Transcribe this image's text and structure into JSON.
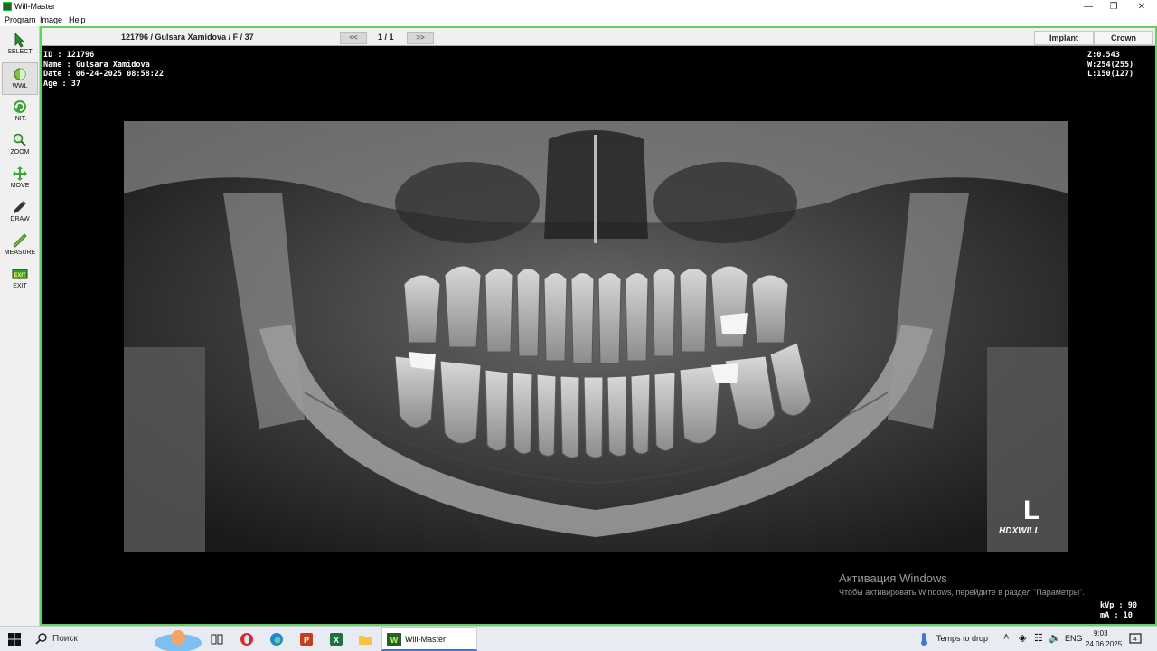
{
  "window": {
    "title": "Will-Master"
  },
  "menu": [
    "Program",
    "Image",
    "Help"
  ],
  "tools": [
    {
      "label": "SELECT",
      "icon": "arrow-cursor-icon"
    },
    {
      "label": "WWL",
      "icon": "contrast-icon"
    },
    {
      "label": "INIT.",
      "icon": "refresh-icon"
    },
    {
      "label": "ZOOM",
      "icon": "magnifier-icon"
    },
    {
      "label": "MOVE",
      "icon": "move-arrows-icon"
    },
    {
      "label": "DRAW",
      "icon": "pen-icon"
    },
    {
      "label": "MEASURE",
      "icon": "ruler-icon"
    },
    {
      "label": "EXIT",
      "icon": "exit-icon"
    }
  ],
  "header": {
    "patient": "121796 / Gulsara Xamidova / F / 37",
    "prev": "<<",
    "page": "1 / 1",
    "next": ">>",
    "implant": "Implant",
    "crown": "Crown"
  },
  "overlay": {
    "id": "ID : 121796",
    "name": "Name : Gulsara Xamidova",
    "date": "Date : 06-24-2025 08:58:22",
    "age": "Age : 37",
    "zoom": "Z:0.543",
    "window": "W:254(255)",
    "level": "L:150(127)",
    "kvp": "kVp : 90",
    "ma": "mA : 10",
    "side_marker": "L",
    "brand": "HDXWILL"
  },
  "activation": {
    "title": "Активация Windows",
    "subtitle": "Чтобы активировать Windows, перейдите в раздел \"Параметры\"."
  },
  "taskbar": {
    "search": "Поиск",
    "app": "Will-Master",
    "weather": "Temps to drop",
    "lang": "ENG",
    "time": "9:03",
    "date": "24.06.2025"
  },
  "colors": {
    "frame": "#5fd35f",
    "accent": "#3b78d8"
  }
}
